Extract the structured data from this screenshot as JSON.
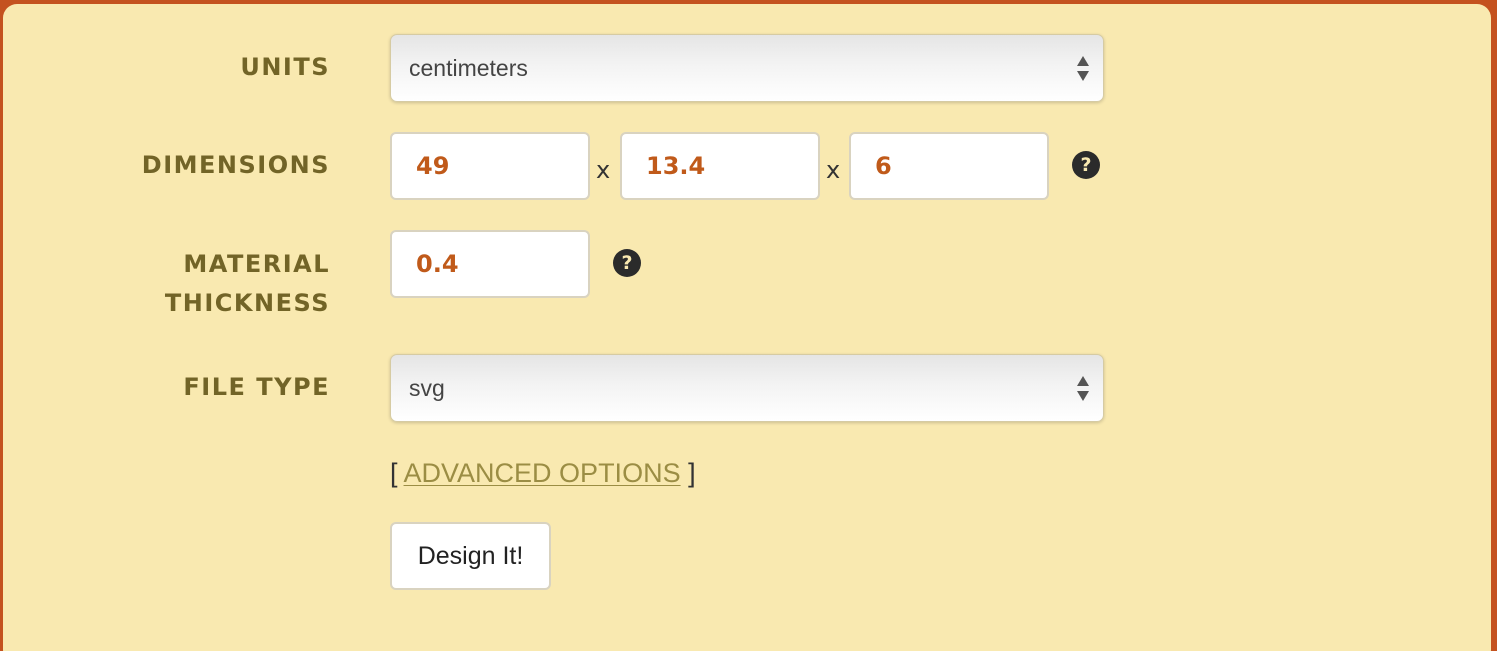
{
  "form": {
    "units": {
      "label": "UNITS",
      "selected": "centimeters"
    },
    "dimensions": {
      "label": "DIMENSIONS",
      "length": "49",
      "width": "13.4",
      "height": "6",
      "separator": "x",
      "help_symbol": "?"
    },
    "material_thickness": {
      "label_line1": "MATERIAL",
      "label_line2": "THICKNESS",
      "value": "0.4",
      "help_symbol": "?"
    },
    "file_type": {
      "label": "FILE TYPE",
      "selected": "svg"
    },
    "advanced_options": {
      "open_bracket": "[",
      "link_text": "ADVANCED OPTIONS",
      "close_bracket": "]"
    },
    "submit": {
      "label": "Design It!"
    }
  },
  "colors": {
    "frame": "#c4521f",
    "panel": "#f9e9b0",
    "label_text": "#726427",
    "input_value": "#c05a1a",
    "link": "#9b8d44"
  },
  "icons": {
    "help": "question-circle-icon",
    "select_arrows": "sort-arrows-icon"
  }
}
